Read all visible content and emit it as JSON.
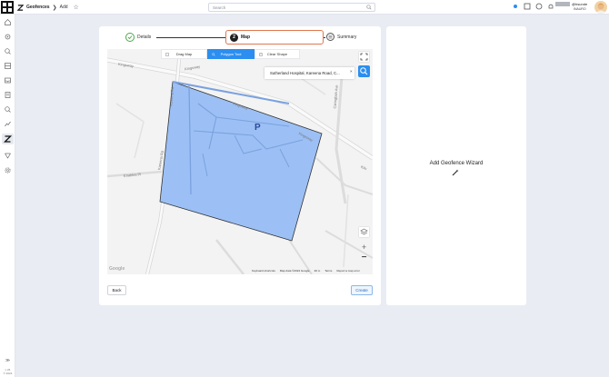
{
  "header": {
    "breadcrumb_title": "Geofences",
    "breadcrumb_separator": "❯",
    "breadcrumb_current": "Add",
    "search_placeholder": "Search",
    "user_handle": "@hsunde",
    "user_org": "INAURO",
    "icons": [
      "breadcrumb-geofence-icon",
      "star-icon",
      "search-icon",
      "status-dot-icon",
      "fullscreen-icon",
      "help-icon",
      "notification-icon"
    ]
  },
  "sidebar": {
    "icons": [
      "home-icon",
      "settings-icon",
      "search-icon",
      "layout-icon",
      "inbox-icon",
      "document-icon",
      "zoom-icon",
      "analytics-icon",
      "geofence-icon",
      "route-icon",
      "gear-icon"
    ],
    "expand_label": "≫",
    "version_line1": "v 26",
    "version_line2": "© 2024"
  },
  "stepper": {
    "steps": [
      {
        "label": "Details",
        "state": "done"
      },
      {
        "number": "2",
        "label": "Map",
        "state": "active"
      },
      {
        "label": "Summary",
        "state": "pending"
      }
    ]
  },
  "map": {
    "tools": [
      {
        "label": "Drag Map",
        "icon": "hand-icon"
      },
      {
        "label": "Polygon Tool",
        "icon": "polygon-icon",
        "active": true
      },
      {
        "label": "Clear Shape",
        "icon": "trash-icon"
      }
    ],
    "search_value": "Sutherland Hospital, Kareena Road, C...",
    "search_close": "×",
    "roads": [
      "Kingsway",
      "Kareena Rd",
      "Kingsway",
      "Kingsway",
      "Kingsway",
      "Caringbah Ave",
      "Kareena Rd",
      "Kiln",
      "Enables Pl"
    ],
    "parking_label": "P",
    "attribution": "Google",
    "footer": [
      "Keyboard shortcuts",
      "Map data ©2024 Google",
      "20 m",
      "Terms",
      "Report a map error"
    ],
    "zoom_in": "+",
    "zoom_out": "−",
    "polygon_color": "#9cc0f5"
  },
  "actions": {
    "back_label": "Back",
    "create_label": "Create"
  },
  "wizard": {
    "title": "Add Geofence Wizard",
    "icon": "magic-wand-icon"
  },
  "colors": {
    "accent": "#2b8ef0",
    "step_active_border": "#e07850",
    "step_done": "#4aa84a"
  }
}
